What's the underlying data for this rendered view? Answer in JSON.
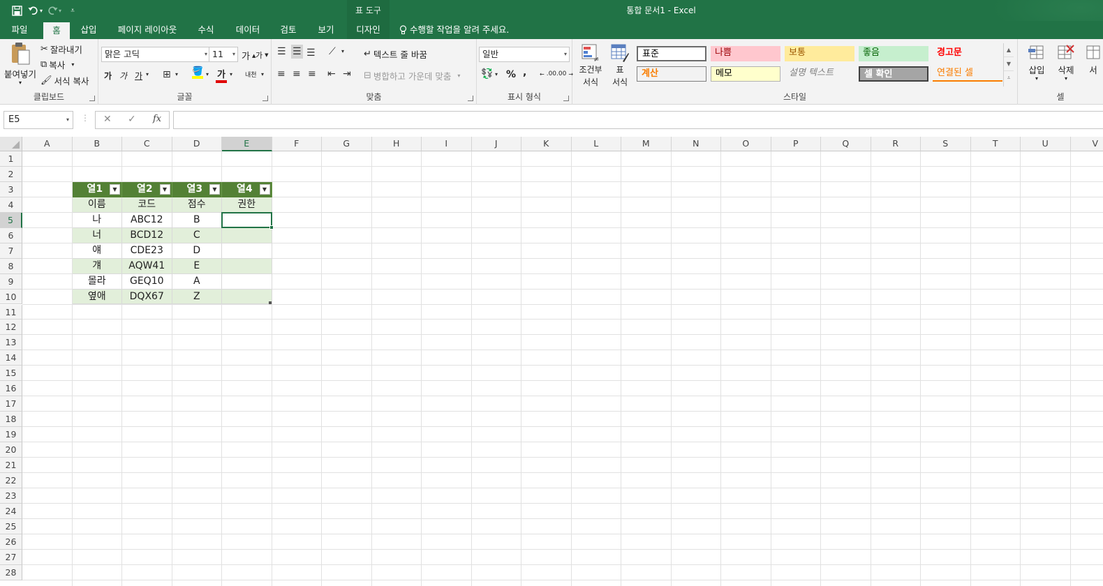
{
  "app": {
    "title": "통합 문서1 - Excel",
    "context_tab_group": "표 도구"
  },
  "tabs": [
    {
      "label": "파일",
      "active": false
    },
    {
      "label": "홈",
      "active": true
    },
    {
      "label": "삽입",
      "active": false
    },
    {
      "label": "페이지 레이아웃",
      "active": false
    },
    {
      "label": "수식",
      "active": false
    },
    {
      "label": "데이터",
      "active": false
    },
    {
      "label": "검토",
      "active": false
    },
    {
      "label": "보기",
      "active": false
    },
    {
      "label": "디자인",
      "active": false
    }
  ],
  "tell_me": "수행할 작업을 알려 주세요.",
  "ribbon": {
    "clipboard": {
      "label": "클립보드",
      "paste": "붙여넣기",
      "cut": "잘라내기",
      "copy": "복사",
      "format_painter": "서식 복사"
    },
    "font": {
      "label": "글꼴",
      "font_name": "맑은 고딕",
      "font_size": "11",
      "grow": "가",
      "shrink": "가",
      "bold": "가",
      "italic": "가",
      "underline": "가",
      "font_color": "가",
      "phonetic": "내천"
    },
    "alignment": {
      "label": "맞춤",
      "wrap_text": "텍스트 줄 바꿈",
      "merge_center": "병합하고 가운데 맞춤"
    },
    "number": {
      "label": "표시 형식",
      "format": "일반",
      "percent": "%",
      "comma": ",",
      "inc_decimal": ".00",
      "dec_decimal": ".00"
    },
    "styles": {
      "label": "스타일",
      "conditional": [
        "조건부",
        "서식"
      ],
      "format_table": [
        "표",
        "서식"
      ],
      "cells": [
        {
          "label": "표준",
          "bg": "#ffffff",
          "fg": "#000000"
        },
        {
          "label": "나쁨",
          "bg": "#ffc7ce",
          "fg": "#9c0006"
        },
        {
          "label": "보통",
          "bg": "#ffeb9c",
          "fg": "#9c5700"
        },
        {
          "label": "좋음",
          "bg": "#c6efce",
          "fg": "#006100"
        },
        {
          "label": "경고문",
          "bg": "#f3f3f3",
          "fg": "#ff0000"
        },
        {
          "label": "계산",
          "bg": "#f2f2f2",
          "fg": "#fa7d00"
        },
        {
          "label": "메모",
          "bg": "#ffffcc",
          "fg": "#000000"
        },
        {
          "label": "설명 텍스트",
          "bg": "#f3f3f3",
          "fg": "#7f7f7f"
        },
        {
          "label": "셀 확인",
          "bg": "#a5a5a5",
          "fg": "#ffffff"
        },
        {
          "label": "연결된 셀",
          "bg": "#f3f3f3",
          "fg": "#fa7d00"
        }
      ]
    },
    "cells": {
      "label": "셀",
      "insert": "삽입",
      "delete": "삭제",
      "format_partial": "서"
    }
  },
  "formula_bar": {
    "name_box": "E5",
    "cancel": "✕",
    "enter": "✓",
    "fx": "fx",
    "value": ""
  },
  "sheet": {
    "columns": [
      "A",
      "B",
      "C",
      "D",
      "E",
      "F",
      "G",
      "H",
      "I",
      "J",
      "K",
      "L",
      "M",
      "N",
      "O",
      "P",
      "Q",
      "R",
      "S",
      "T",
      "U",
      "V"
    ],
    "rows": [
      "1",
      "2",
      "3",
      "4",
      "5",
      "6",
      "7",
      "8",
      "9",
      "10",
      "11",
      "12",
      "13",
      "14",
      "15",
      "16",
      "17",
      "18",
      "19",
      "20",
      "21",
      "22",
      "23",
      "24",
      "25",
      "26",
      "27",
      "28"
    ],
    "selected_column": "E",
    "selected_row": "5",
    "table": {
      "headers": [
        "열1",
        "열2",
        "열3",
        "열4"
      ],
      "rows": [
        [
          "이름",
          "코드",
          "점수",
          "권한"
        ],
        [
          "나",
          "ABC12",
          "B",
          ""
        ],
        [
          "너",
          "BCD12",
          "C",
          ""
        ],
        [
          "얘",
          "CDE23",
          "D",
          ""
        ],
        [
          "걔",
          "AQW41",
          "E",
          ""
        ],
        [
          "몰라",
          "GEQ10",
          "A",
          ""
        ],
        [
          "옆애",
          "DQX67",
          "Z",
          ""
        ]
      ]
    }
  },
  "colors": {
    "excel_green": "#217346",
    "table_header": "#538135",
    "table_band": "#e2efda"
  }
}
